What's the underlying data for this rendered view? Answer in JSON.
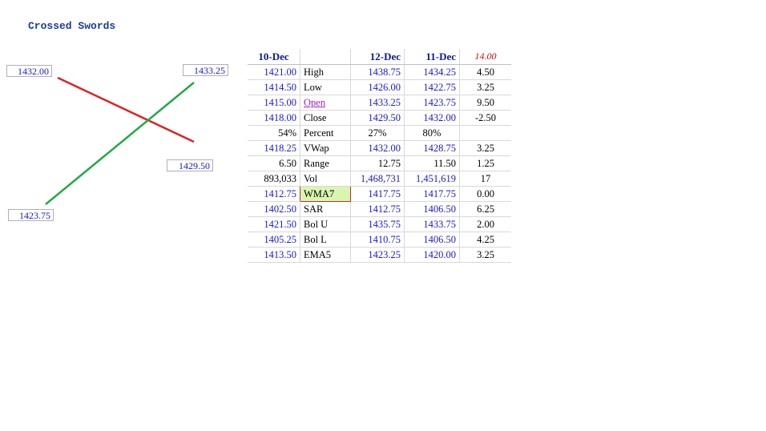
{
  "title": "Crossed Swords",
  "crossing": {
    "red_line": {
      "from_label": "1432.00",
      "to_label": "1429.50",
      "color": "#dd2222"
    },
    "green_line": {
      "from_label": "1423.75",
      "to_label": "1433.25",
      "color": "#22aa44"
    }
  },
  "table": {
    "headers": [
      "10-Dec",
      "",
      "12-Dec",
      "11-Dec",
      "14.00"
    ],
    "rows": [
      [
        "1421.00",
        "High",
        "1438.75",
        "1434.25",
        "4.50"
      ],
      [
        "1414.50",
        "Low",
        "1426.00",
        "1422.75",
        "3.25"
      ],
      [
        "1415.00",
        "Open",
        "1433.25",
        "1423.75",
        "9.50"
      ],
      [
        "1418.00",
        "Close",
        "1429.50",
        "1432.00",
        "-2.50"
      ],
      [
        "54%",
        "Percent",
        "27%",
        "80%",
        ""
      ],
      [
        "1418.25",
        "VWap",
        "1432.00",
        "1428.75",
        "3.25"
      ],
      [
        "6.50",
        "Range",
        "12.75",
        "11.50",
        "1.25"
      ],
      [
        "893,033",
        "Vol",
        "1,468,731",
        "1,451,619",
        "17"
      ],
      [
        "1412.75",
        "WMA7",
        "1417.75",
        "1417.75",
        "0.00"
      ],
      [
        "1402.50",
        "SAR",
        "1412.75",
        "1406.50",
        "6.25"
      ],
      [
        "1421.50",
        "Bol U",
        "1435.75",
        "1433.75",
        "2.00"
      ],
      [
        "1405.25",
        "Bol L",
        "1410.75",
        "1406.50",
        "4.25"
      ],
      [
        "1413.50",
        "EMA5",
        "1423.25",
        "1420.00",
        "3.25"
      ]
    ]
  }
}
